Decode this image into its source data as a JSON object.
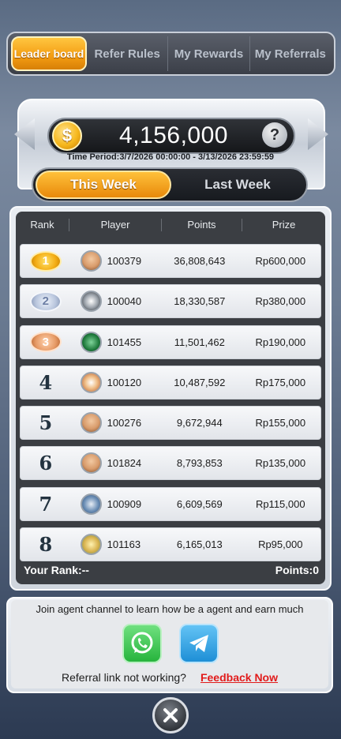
{
  "top_tabs": [
    {
      "label": "Leader board",
      "active": true
    },
    {
      "label": "Refer Rules",
      "active": false
    },
    {
      "label": "My Rewards",
      "active": false
    },
    {
      "label": "My Referrals",
      "active": false
    }
  ],
  "jackpot": {
    "coin_symbol": "$",
    "amount": "4,156,000",
    "help_symbol": "?",
    "time_period": "Time Period:3/7/2026 00:00:00 - 3/13/2026 23:59:59"
  },
  "week_tabs": [
    {
      "label": "This Week",
      "active": true
    },
    {
      "label": "Last Week",
      "active": false
    }
  ],
  "table": {
    "headers": {
      "rank": "Rank",
      "player": "Player",
      "points": "Points",
      "prize": "Prize"
    },
    "rows": [
      {
        "rank": "1",
        "medal": "gold",
        "player": "100379",
        "points": "36,808,643",
        "prize": "Rp600,000"
      },
      {
        "rank": "2",
        "medal": "silver",
        "player": "100040",
        "points": "18,330,587",
        "prize": "Rp380,000"
      },
      {
        "rank": "3",
        "medal": "bronze",
        "player": "101455",
        "points": "11,501,462",
        "prize": "Rp190,000"
      },
      {
        "rank": "4",
        "player": "100120",
        "points": "10,487,592",
        "prize": "Rp175,000"
      },
      {
        "rank": "5",
        "player": "100276",
        "points": "9,672,944",
        "prize": "Rp155,000"
      },
      {
        "rank": "6",
        "player": "101824",
        "points": "8,793,853",
        "prize": "Rp135,000"
      },
      {
        "rank": "7",
        "player": "100909",
        "points": "6,609,569",
        "prize": "Rp115,000"
      },
      {
        "rank": "8",
        "player": "101163",
        "points": "6,165,013",
        "prize": "Rp95,000"
      }
    ]
  },
  "your_rank": "Your Rank:--",
  "your_points": "Points:0",
  "agent": {
    "text": "Join agent channel to learn how be a agent and earn much",
    "whatsapp_icon": "whatsapp-icon",
    "telegram_icon": "telegram-icon"
  },
  "referral": {
    "text": "Referral link not working?",
    "link": "Feedback Now"
  },
  "colors": {
    "accent_gold": "#f39c12",
    "feedback_red": "#e11b1b",
    "whatsapp_green": "#27b43d",
    "telegram_blue": "#1e8fd6"
  }
}
